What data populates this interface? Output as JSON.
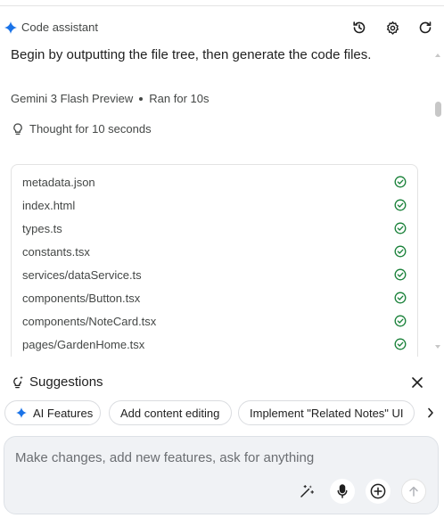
{
  "header": {
    "title": "Code assistant",
    "icons": [
      "spark-icon",
      "history-icon",
      "gear-icon",
      "refresh-icon"
    ]
  },
  "conversation": {
    "prompt": "Begin by outputting the file tree, then generate the code files.",
    "model": "Gemini 3 Flash Preview",
    "run_status": "Ran for 10s",
    "thought": "Thought for 10 seconds"
  },
  "files": [
    {
      "name": "metadata.json",
      "status": "done"
    },
    {
      "name": "index.html",
      "status": "done"
    },
    {
      "name": "types.ts",
      "status": "done"
    },
    {
      "name": "constants.tsx",
      "status": "done"
    },
    {
      "name": "services/dataService.ts",
      "status": "done"
    },
    {
      "name": "components/Button.tsx",
      "status": "done"
    },
    {
      "name": "components/NoteCard.tsx",
      "status": "done"
    },
    {
      "name": "pages/GardenHome.tsx",
      "status": "done"
    }
  ],
  "suggestions": {
    "title": "Suggestions",
    "chips": [
      {
        "label": "AI Features",
        "icon": "spark-icon"
      },
      {
        "label": "Add content editing"
      },
      {
        "label": "Implement \"Related Notes\" UI"
      }
    ]
  },
  "composer": {
    "placeholder": "Make changes, add new features, ask for anything",
    "buttons": [
      "magic-wand-icon",
      "microphone-icon",
      "plus-circle-icon",
      "arrow-up-icon"
    ]
  },
  "colors": {
    "accent": "#1a73e8",
    "check": "#188038",
    "muted_text": "#444746"
  }
}
